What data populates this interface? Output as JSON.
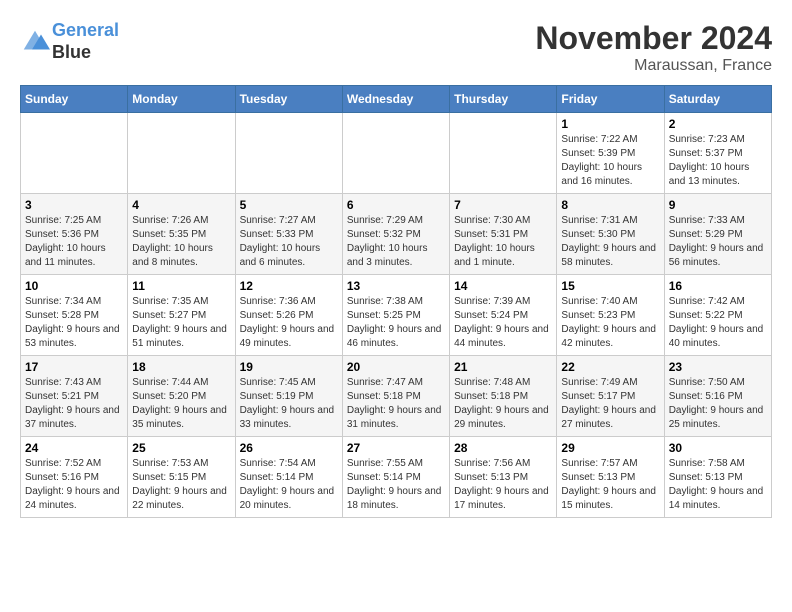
{
  "header": {
    "logo_line1": "General",
    "logo_line2": "Blue",
    "month": "November 2024",
    "location": "Maraussan, France"
  },
  "weekdays": [
    "Sunday",
    "Monday",
    "Tuesday",
    "Wednesday",
    "Thursday",
    "Friday",
    "Saturday"
  ],
  "weeks": [
    [
      {
        "day": "",
        "info": ""
      },
      {
        "day": "",
        "info": ""
      },
      {
        "day": "",
        "info": ""
      },
      {
        "day": "",
        "info": ""
      },
      {
        "day": "",
        "info": ""
      },
      {
        "day": "1",
        "info": "Sunrise: 7:22 AM\nSunset: 5:39 PM\nDaylight: 10 hours and 16 minutes."
      },
      {
        "day": "2",
        "info": "Sunrise: 7:23 AM\nSunset: 5:37 PM\nDaylight: 10 hours and 13 minutes."
      }
    ],
    [
      {
        "day": "3",
        "info": "Sunrise: 7:25 AM\nSunset: 5:36 PM\nDaylight: 10 hours and 11 minutes."
      },
      {
        "day": "4",
        "info": "Sunrise: 7:26 AM\nSunset: 5:35 PM\nDaylight: 10 hours and 8 minutes."
      },
      {
        "day": "5",
        "info": "Sunrise: 7:27 AM\nSunset: 5:33 PM\nDaylight: 10 hours and 6 minutes."
      },
      {
        "day": "6",
        "info": "Sunrise: 7:29 AM\nSunset: 5:32 PM\nDaylight: 10 hours and 3 minutes."
      },
      {
        "day": "7",
        "info": "Sunrise: 7:30 AM\nSunset: 5:31 PM\nDaylight: 10 hours and 1 minute."
      },
      {
        "day": "8",
        "info": "Sunrise: 7:31 AM\nSunset: 5:30 PM\nDaylight: 9 hours and 58 minutes."
      },
      {
        "day": "9",
        "info": "Sunrise: 7:33 AM\nSunset: 5:29 PM\nDaylight: 9 hours and 56 minutes."
      }
    ],
    [
      {
        "day": "10",
        "info": "Sunrise: 7:34 AM\nSunset: 5:28 PM\nDaylight: 9 hours and 53 minutes."
      },
      {
        "day": "11",
        "info": "Sunrise: 7:35 AM\nSunset: 5:27 PM\nDaylight: 9 hours and 51 minutes."
      },
      {
        "day": "12",
        "info": "Sunrise: 7:36 AM\nSunset: 5:26 PM\nDaylight: 9 hours and 49 minutes."
      },
      {
        "day": "13",
        "info": "Sunrise: 7:38 AM\nSunset: 5:25 PM\nDaylight: 9 hours and 46 minutes."
      },
      {
        "day": "14",
        "info": "Sunrise: 7:39 AM\nSunset: 5:24 PM\nDaylight: 9 hours and 44 minutes."
      },
      {
        "day": "15",
        "info": "Sunrise: 7:40 AM\nSunset: 5:23 PM\nDaylight: 9 hours and 42 minutes."
      },
      {
        "day": "16",
        "info": "Sunrise: 7:42 AM\nSunset: 5:22 PM\nDaylight: 9 hours and 40 minutes."
      }
    ],
    [
      {
        "day": "17",
        "info": "Sunrise: 7:43 AM\nSunset: 5:21 PM\nDaylight: 9 hours and 37 minutes."
      },
      {
        "day": "18",
        "info": "Sunrise: 7:44 AM\nSunset: 5:20 PM\nDaylight: 9 hours and 35 minutes."
      },
      {
        "day": "19",
        "info": "Sunrise: 7:45 AM\nSunset: 5:19 PM\nDaylight: 9 hours and 33 minutes."
      },
      {
        "day": "20",
        "info": "Sunrise: 7:47 AM\nSunset: 5:18 PM\nDaylight: 9 hours and 31 minutes."
      },
      {
        "day": "21",
        "info": "Sunrise: 7:48 AM\nSunset: 5:18 PM\nDaylight: 9 hours and 29 minutes."
      },
      {
        "day": "22",
        "info": "Sunrise: 7:49 AM\nSunset: 5:17 PM\nDaylight: 9 hours and 27 minutes."
      },
      {
        "day": "23",
        "info": "Sunrise: 7:50 AM\nSunset: 5:16 PM\nDaylight: 9 hours and 25 minutes."
      }
    ],
    [
      {
        "day": "24",
        "info": "Sunrise: 7:52 AM\nSunset: 5:16 PM\nDaylight: 9 hours and 24 minutes."
      },
      {
        "day": "25",
        "info": "Sunrise: 7:53 AM\nSunset: 5:15 PM\nDaylight: 9 hours and 22 minutes."
      },
      {
        "day": "26",
        "info": "Sunrise: 7:54 AM\nSunset: 5:14 PM\nDaylight: 9 hours and 20 minutes."
      },
      {
        "day": "27",
        "info": "Sunrise: 7:55 AM\nSunset: 5:14 PM\nDaylight: 9 hours and 18 minutes."
      },
      {
        "day": "28",
        "info": "Sunrise: 7:56 AM\nSunset: 5:13 PM\nDaylight: 9 hours and 17 minutes."
      },
      {
        "day": "29",
        "info": "Sunrise: 7:57 AM\nSunset: 5:13 PM\nDaylight: 9 hours and 15 minutes."
      },
      {
        "day": "30",
        "info": "Sunrise: 7:58 AM\nSunset: 5:13 PM\nDaylight: 9 hours and 14 minutes."
      }
    ]
  ]
}
